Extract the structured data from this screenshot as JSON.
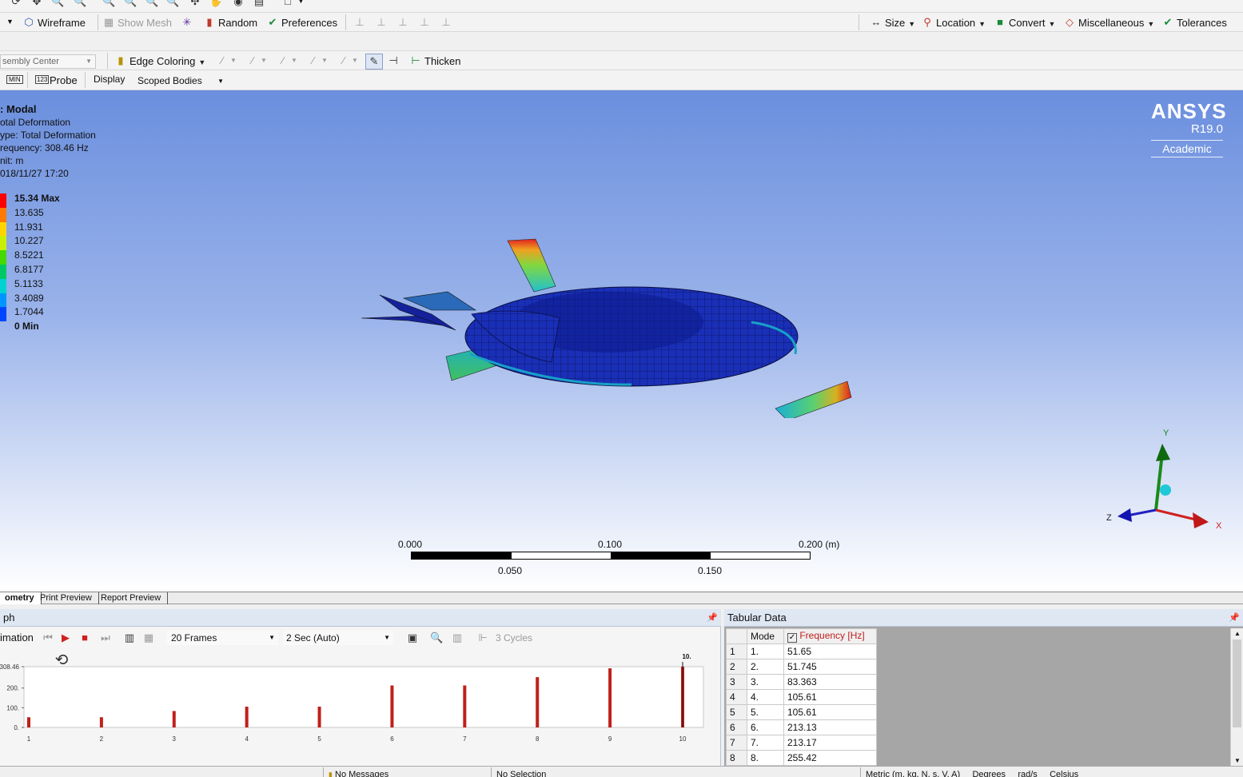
{
  "toolbar1": {
    "wireframe": "Wireframe",
    "show_mesh": "Show Mesh",
    "random": "Random",
    "preferences": "Preferences",
    "size": "Size",
    "location": "Location",
    "convert": "Convert",
    "miscellaneous": "Miscellaneous",
    "tolerances": "Tolerances"
  },
  "toolbar2": {
    "assembly_center": "sembly Center",
    "edge_coloring": "Edge Coloring",
    "thicken": "Thicken"
  },
  "toolbar3": {
    "probe": "Probe",
    "display_label": "Display",
    "display_value": "Scoped Bodies"
  },
  "result_info": {
    "line1": ": Modal",
    "line2": "otal Deformation",
    "line3": "ype: Total Deformation",
    "line4": "requency: 308.46 Hz",
    "line5": "nit: m",
    "line6": "018/11/27 17:20"
  },
  "legend": {
    "levels": [
      "15.34 Max",
      "13.635",
      "11.931",
      "10.227",
      "8.5221",
      "6.8177",
      "5.1133",
      "3.4089",
      "1.7044",
      "0 Min"
    ],
    "colors": [
      "#ff0000",
      "#ff7a00",
      "#ffd500",
      "#c8f000",
      "#46d800",
      "#00c864",
      "#00d2d2",
      "#0096ff",
      "#0046ff",
      "#0000e6"
    ]
  },
  "branding": {
    "product": "ANSYS",
    "release": "R19.0",
    "license": "Academic"
  },
  "scale_bar": {
    "top_labels": [
      "0.000",
      "0.100",
      "0.200 (m)"
    ],
    "bottom_labels": [
      "0.050",
      "0.150"
    ]
  },
  "triad": {
    "x": "X",
    "y": "Y",
    "z": "Z"
  },
  "tabs": [
    "ometry",
    "Print Preview",
    "Report Preview"
  ],
  "graph_panel": {
    "title": "ph",
    "animation_label": "imation",
    "frames": "20 Frames",
    "duration": "2 Sec (Auto)",
    "cycles": "3 Cycles"
  },
  "chart_data": {
    "type": "bar",
    "categories": [
      "1",
      "2",
      "3",
      "4",
      "5",
      "6",
      "7",
      "8",
      "9",
      "10"
    ],
    "values": [
      51.65,
      51.745,
      83.363,
      105.61,
      105.61,
      213.13,
      213.17,
      255.42,
      300.2,
      308.46
    ],
    "yticks": [
      "0.",
      "100.",
      "200.",
      "308.46"
    ],
    "ylim": [
      0,
      308.46
    ],
    "marker_label": "10.",
    "bar_color": "#c0201a"
  },
  "tabular": {
    "title": "Tabular Data",
    "col_mode": "Mode",
    "col_freq": "Frequency [Hz]",
    "rows": [
      {
        "n": "1",
        "mode": "1.",
        "freq": "51.65"
      },
      {
        "n": "2",
        "mode": "2.",
        "freq": "51.745"
      },
      {
        "n": "3",
        "mode": "3.",
        "freq": "83.363"
      },
      {
        "n": "4",
        "mode": "4.",
        "freq": "105.61"
      },
      {
        "n": "5",
        "mode": "5.",
        "freq": "105.61"
      },
      {
        "n": "6",
        "mode": "6.",
        "freq": "213.13"
      },
      {
        "n": "7",
        "mode": "7.",
        "freq": "213.17"
      },
      {
        "n": "8",
        "mode": "8.",
        "freq": "255.42"
      }
    ]
  },
  "statusbar": {
    "messages": "No Messages",
    "selection": "No Selection",
    "units": "Metric (m, kg, N, s, V, A)",
    "angle": "Degrees",
    "rate": "rad/s",
    "temp": "Celsius"
  }
}
